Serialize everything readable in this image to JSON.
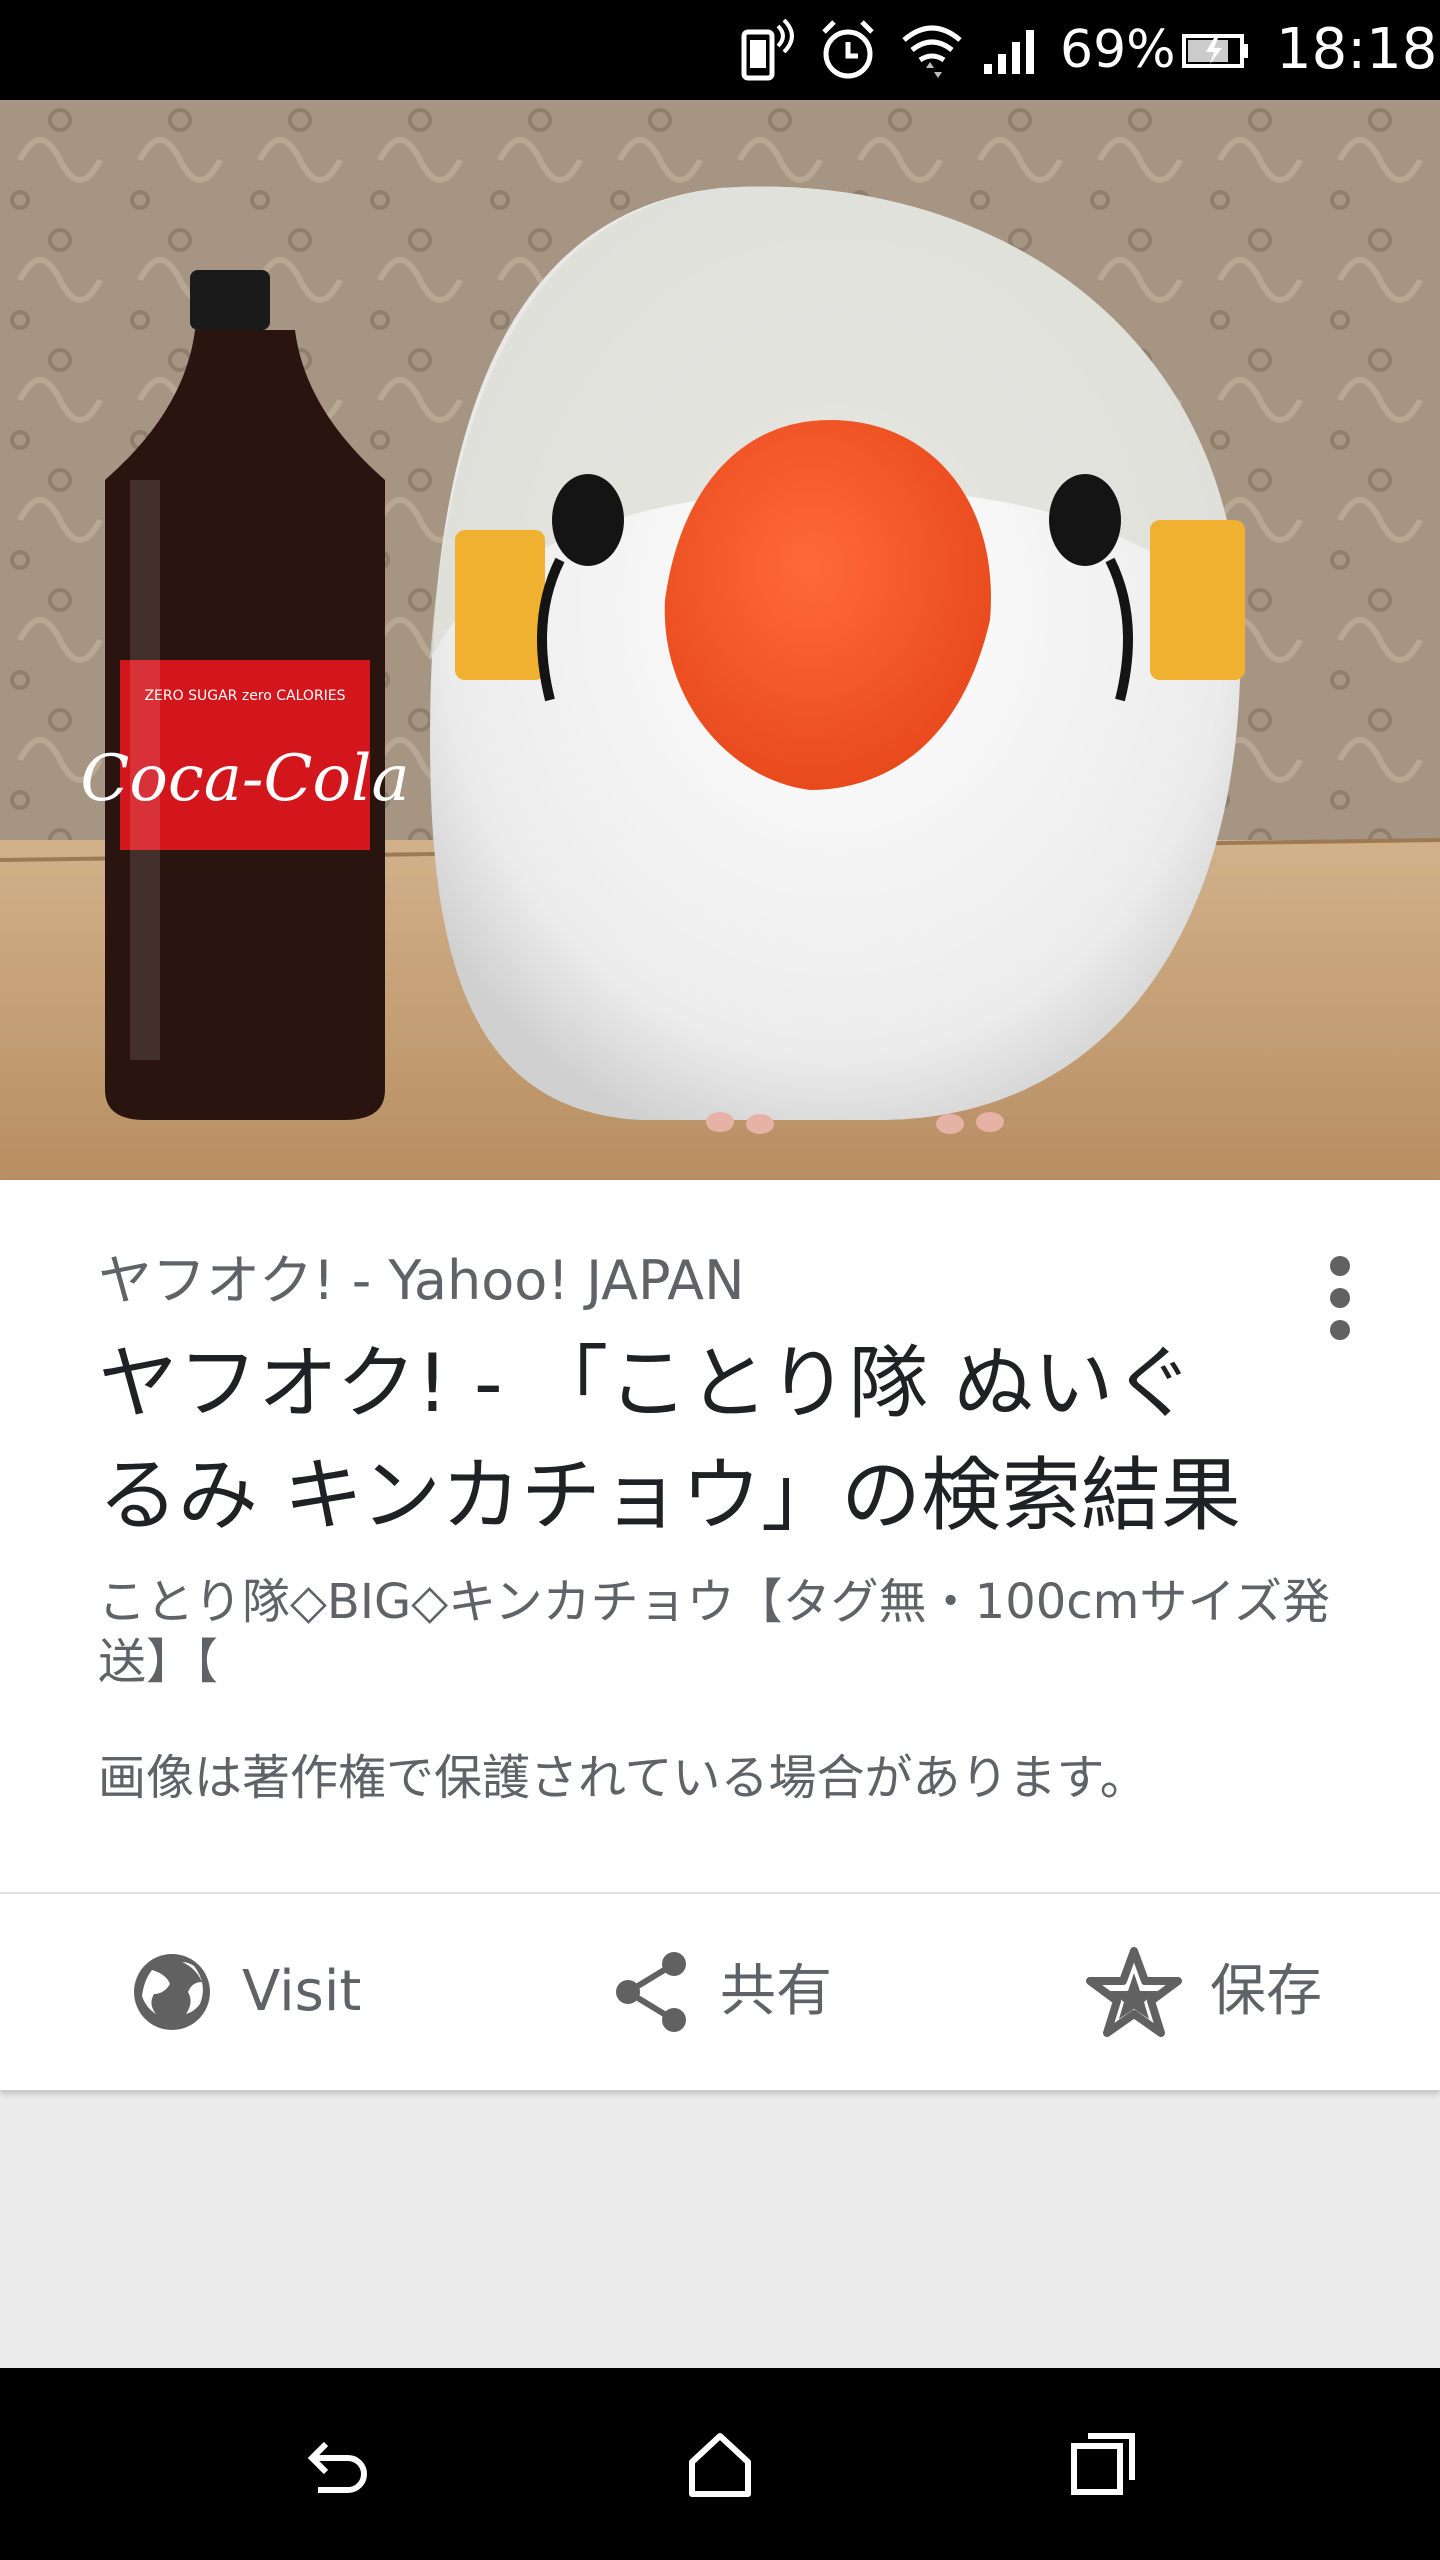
{
  "status_bar": {
    "battery_percent": "69%",
    "time": "18:18",
    "icons": [
      "phone-vibrate-icon",
      "alarm-icon",
      "wifi-icon",
      "signal-icon",
      "battery-icon"
    ]
  },
  "hero_image": {
    "description_icon": "product-photo",
    "bottle_label": "Coca-Cola",
    "bottle_small_text": "ZERO SUGAR zero CALORIES"
  },
  "result": {
    "source": "ヤフオク! - Yahoo! JAPAN",
    "title": "ヤフオク! - 「ことり隊 ぬいぐるみ キンカチョウ」の検索結果",
    "snippet": "ことり隊◇BIG◇キンカチョウ【タグ無・100cmサイズ発送】【",
    "copyright_notice": "画像は著作権で保護されている場合があります。"
  },
  "actions": {
    "visit_label": "Visit",
    "share_label": "共有",
    "save_label": "保存"
  },
  "nav_bar": {
    "icons": [
      "back-icon",
      "home-icon",
      "recents-icon"
    ]
  },
  "colors": {
    "status_bar_bg": "#000000",
    "card_bg": "#ffffff",
    "page_bg": "#ececec",
    "text_primary": "#202124",
    "text_secondary": "#5f6368"
  }
}
